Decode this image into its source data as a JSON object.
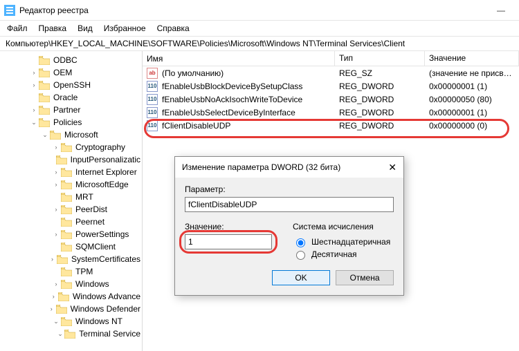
{
  "window": {
    "title": "Редактор реестра",
    "minimize": "—"
  },
  "menu": {
    "file": "Файл",
    "edit": "Правка",
    "view": "Вид",
    "favorites": "Избранное",
    "help": "Справка"
  },
  "path": "Компьютер\\HKEY_LOCAL_MACHINE\\SOFTWARE\\Policies\\Microsoft\\Windows NT\\Terminal Services\\Client",
  "tree": [
    {
      "indent": 42,
      "tw": "",
      "label": "ODBC"
    },
    {
      "indent": 42,
      "tw": "›",
      "label": "OEM"
    },
    {
      "indent": 42,
      "tw": "›",
      "label": "OpenSSH"
    },
    {
      "indent": 42,
      "tw": "",
      "label": "Oracle"
    },
    {
      "indent": 42,
      "tw": "›",
      "label": "Partner"
    },
    {
      "indent": 42,
      "tw": "⌄",
      "label": "Policies"
    },
    {
      "indent": 58,
      "tw": "⌄",
      "label": "Microsoft"
    },
    {
      "indent": 74,
      "tw": "›",
      "label": "Cryptography"
    },
    {
      "indent": 74,
      "tw": "",
      "label": "InputPersonalizatic"
    },
    {
      "indent": 74,
      "tw": "›",
      "label": "Internet Explorer"
    },
    {
      "indent": 74,
      "tw": "›",
      "label": "MicrosoftEdge"
    },
    {
      "indent": 74,
      "tw": "",
      "label": "MRT"
    },
    {
      "indent": 74,
      "tw": "›",
      "label": "PeerDist"
    },
    {
      "indent": 74,
      "tw": "",
      "label": "Peernet"
    },
    {
      "indent": 74,
      "tw": "›",
      "label": "PowerSettings"
    },
    {
      "indent": 74,
      "tw": "",
      "label": "SQMClient"
    },
    {
      "indent": 74,
      "tw": "›",
      "label": "SystemCertificates"
    },
    {
      "indent": 74,
      "tw": "",
      "label": "TPM"
    },
    {
      "indent": 74,
      "tw": "›",
      "label": "Windows"
    },
    {
      "indent": 74,
      "tw": "›",
      "label": "Windows Advance"
    },
    {
      "indent": 74,
      "tw": "›",
      "label": "Windows Defender"
    },
    {
      "indent": 74,
      "tw": "⌄",
      "label": "Windows NT"
    },
    {
      "indent": 90,
      "tw": "⌄",
      "label": "Terminal Service"
    }
  ],
  "list": {
    "header": {
      "name": "Имя",
      "type": "Тип",
      "value": "Значение"
    },
    "rows": [
      {
        "icon": "sz",
        "name": "(По умолчанию)",
        "type": "REG_SZ",
        "value": "(значение не присвоено)"
      },
      {
        "icon": "dw",
        "name": "fEnableUsbBlockDeviceBySetupClass",
        "type": "REG_DWORD",
        "value": "0x00000001 (1)"
      },
      {
        "icon": "dw",
        "name": "fEnableUsbNoAckIsochWriteToDevice",
        "type": "REG_DWORD",
        "value": "0x00000050 (80)"
      },
      {
        "icon": "dw",
        "name": "fEnableUsbSelectDeviceByInterface",
        "type": "REG_DWORD",
        "value": "0x00000001 (1)"
      },
      {
        "icon": "dw",
        "name": "fClientDisableUDP",
        "type": "REG_DWORD",
        "value": "0x00000000 (0)"
      }
    ]
  },
  "dialog": {
    "title": "Изменение параметра DWORD (32 бита)",
    "param_label": "Параметр:",
    "param_value": "fClientDisableUDP",
    "value_label": "Значение:",
    "value_input": "1",
    "base_label": "Система исчисления",
    "radio_hex": "Шестнадцатеричная",
    "radio_dec": "Десятичная",
    "ok": "OK",
    "cancel": "Отмена"
  }
}
